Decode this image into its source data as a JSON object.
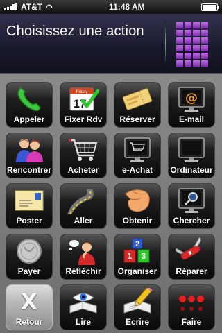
{
  "status_bar": {
    "carrier": "AT&T",
    "time": "11:48 AM"
  },
  "header": {
    "title": "Choisissez une action"
  },
  "colors": {
    "header_bg": "#1b1b30",
    "grid_icon": "#9b4bc8",
    "tile_bg": "#111111",
    "main_bg": "#7c7c7c"
  },
  "tiles": [
    {
      "label": "Appeler",
      "icon": "phone-icon"
    },
    {
      "label": "Fixer Rdv",
      "icon": "calendar-check-icon",
      "icon_text": "Friday",
      "day": "17"
    },
    {
      "label": "Réserver",
      "icon": "ticket-icon"
    },
    {
      "label": "E-mail",
      "icon": "at-monitor-icon",
      "icon_text": "@"
    },
    {
      "label": "Rencontrer",
      "icon": "people-icon"
    },
    {
      "label": "Acheter",
      "icon": "shopping-cart-icon"
    },
    {
      "label": "e-Achat",
      "icon": "cart-monitor-icon"
    },
    {
      "label": "Ordinateur",
      "icon": "monitor-icon"
    },
    {
      "label": "Poster",
      "icon": "letter-icon"
    },
    {
      "label": "Aller",
      "icon": "road-icon"
    },
    {
      "label": "Obtenir",
      "icon": "hand-grab-icon"
    },
    {
      "label": "Chercher",
      "icon": "magnifier-monitor-icon"
    },
    {
      "label": "Payer",
      "icon": "coin-icon"
    },
    {
      "label": "Réfléchir",
      "icon": "thinking-person-icon"
    },
    {
      "label": "Organiser",
      "icon": "blocks-icon",
      "block_numbers": [
        "1",
        "2",
        "3"
      ]
    },
    {
      "label": "Réparer",
      "icon": "swiss-knife-icon"
    },
    {
      "label": "Retour",
      "icon": "close-icon",
      "icon_text": "X"
    },
    {
      "label": "Lire",
      "icon": "eye-book-icon"
    },
    {
      "label": "Ecrire",
      "icon": "pencil-paper-icon"
    },
    {
      "label": "Faire",
      "icon": "three-dots-icon"
    }
  ]
}
